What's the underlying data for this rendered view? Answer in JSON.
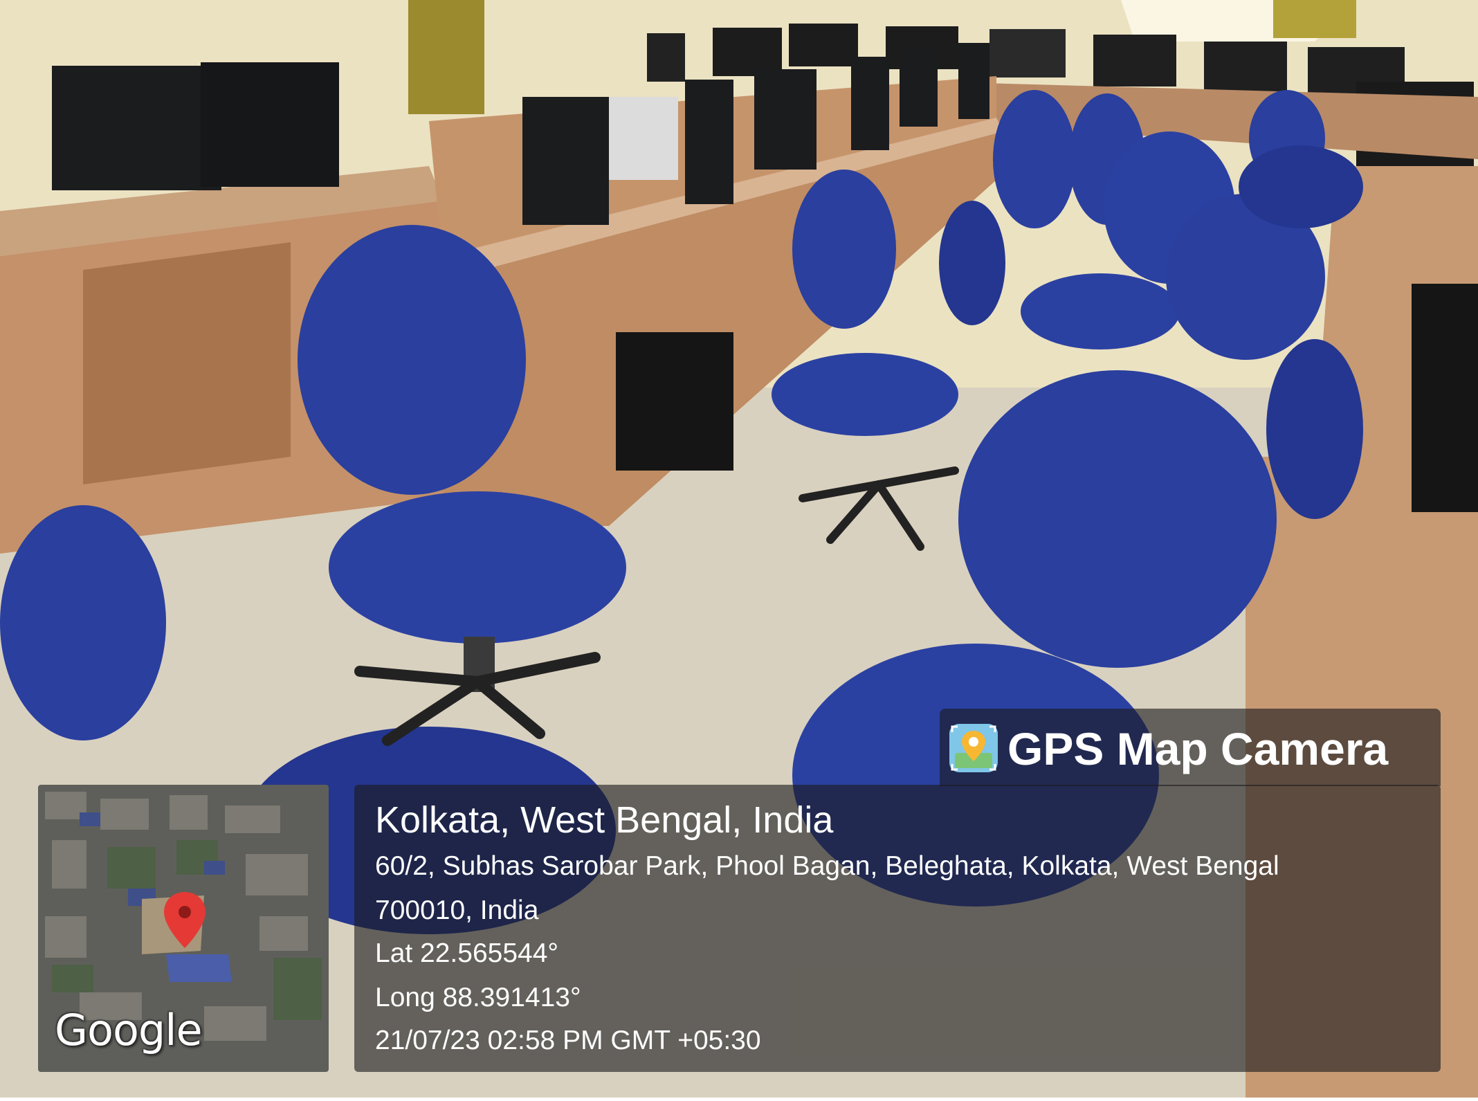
{
  "overlay": {
    "brand": "GPS Map Camera",
    "location_title": "Kolkata, West Bengal, India",
    "address_line1": "60/2, Subhas Sarobar Park, Phool Bagan, Beleghata, Kolkata, West Bengal",
    "address_line2": "700010, India",
    "latitude": "Lat 22.565544°",
    "longitude": "Long 88.391413°",
    "timestamp": "21/07/23 02:58 PM GMT +05:30",
    "map_logo": "Google",
    "brand_icon": "map-pin-camera-icon"
  },
  "colors": {
    "wall": "#ebe2c2",
    "floor": "#d9d1bf",
    "desk_wood": "#c4916a",
    "desk_dark": "#8d5a3c",
    "chair_blue": "#2a3f9e",
    "chair_shadow": "#1b2a70",
    "monitor": "#1b1c1e",
    "panel": "rgba(28,28,30,0.62)",
    "map_pin": "#e53935"
  }
}
